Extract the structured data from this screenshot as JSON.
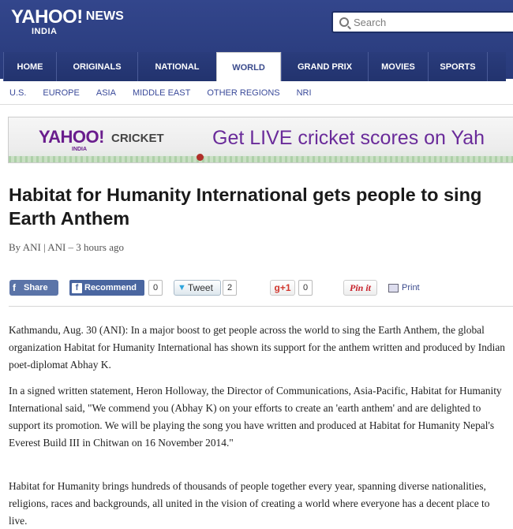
{
  "header": {
    "brand": "YAHOO!",
    "section": "NEWS",
    "region": "INDIA",
    "search_placeholder": "Search"
  },
  "nav": {
    "tabs": [
      {
        "label": "HOME"
      },
      {
        "label": "ORIGINALS"
      },
      {
        "label": "NATIONAL"
      },
      {
        "label": "WORLD",
        "active": true
      },
      {
        "label": "GRAND PRIX"
      },
      {
        "label": "MOVIES"
      },
      {
        "label": "SPORTS"
      }
    ],
    "subnav": [
      "U.S.",
      "EUROPE",
      "ASIA",
      "MIDDLE EAST",
      "OTHER REGIONS",
      "NRI"
    ]
  },
  "banner": {
    "logo": "YAHOO!",
    "logo_region": "INDIA",
    "product": "CRICKET",
    "tagline": "Get LIVE cricket scores on Yah"
  },
  "article": {
    "headline": "Habitat for Humanity International gets people to sing Earth Anthem",
    "byline": "By ANI | ANI – 3 hours ago",
    "share": {
      "facebook_share": "Share",
      "recommend": "Recommend",
      "recommend_count": "0",
      "tweet": "Tweet",
      "tweet_count": "2",
      "gplus": "g+1",
      "gplus_count": "0",
      "pin": "Pin it",
      "print": "Print"
    },
    "paragraphs": [
      "Kathmandu, Aug. 30 (ANI): In a major boost to get people across the world to sing the Earth Anthem, the global organization Habitat for Humanity International has shown its support for the anthem written and produced by Indian poet-diplomat Abhay K.",
      "In a signed written statement, Heron Holloway, the Director of Communications, Asia-Pacific, Habitat for Humanity International said, \"We commend you (Abhay K) on your efforts to create an 'earth anthem' and are delighted to support its promotion. We will be playing the song you have written and produced at Habitat for Humanity Nepal's Everest Build III in Chitwan on 16 November 2014.\"",
      "Habitat for Humanity brings hundreds of thousands of people together every year, spanning diverse nationalities, religions, races and backgrounds, all united in the vision of creating a world where everyone has a decent place to live."
    ]
  },
  "colors": {
    "header_bg": "#2e4185",
    "link": "#3a4a9a",
    "banner_text": "#6a2b9a"
  }
}
